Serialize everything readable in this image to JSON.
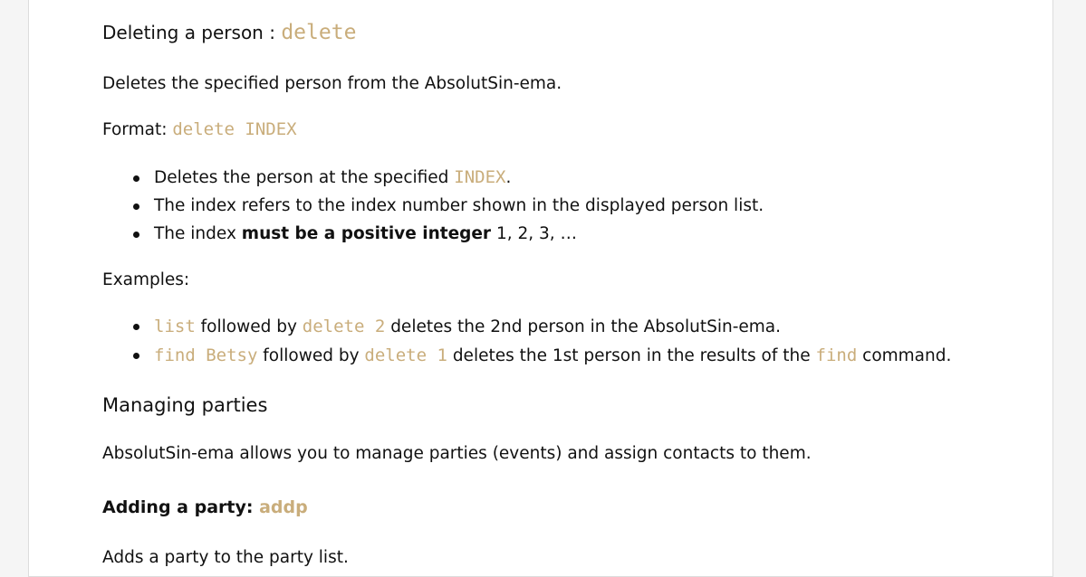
{
  "delete_section": {
    "heading": "Deleting a person : ",
    "heading_code": "delete",
    "description": "Deletes the specified person from the AbsolutSin-ema.",
    "format_label": "Format: ",
    "format_code": "delete INDEX",
    "notes": {
      "n1_pre": "Deletes the person at the specified ",
      "n1_code": "INDEX",
      "n1_post": ".",
      "n2": "The index refers to the index number shown in the displayed person list.",
      "n3_pre": "The index ",
      "n3_bold": "must be a positive integer",
      "n3_post": " 1, 2, 3, …"
    },
    "examples_label": "Examples:",
    "examples": {
      "e1_code1": "list",
      "e1_mid": " followed by ",
      "e1_code2": "delete 2",
      "e1_post": " deletes the 2nd person in the AbsolutSin-ema.",
      "e2_code1": "find Betsy",
      "e2_mid": " followed by ",
      "e2_code2": "delete 1",
      "e2_mid2": " deletes the 1st person in the results of the ",
      "e2_code3": "find",
      "e2_post": " command."
    }
  },
  "parties_section": {
    "heading": "Managing parties",
    "description": "AbsolutSin-ema allows you to manage parties (events) and assign contacts to them.",
    "add_heading": "Adding a party: ",
    "add_code": "addp",
    "add_description": "Adds a party to the party list."
  }
}
